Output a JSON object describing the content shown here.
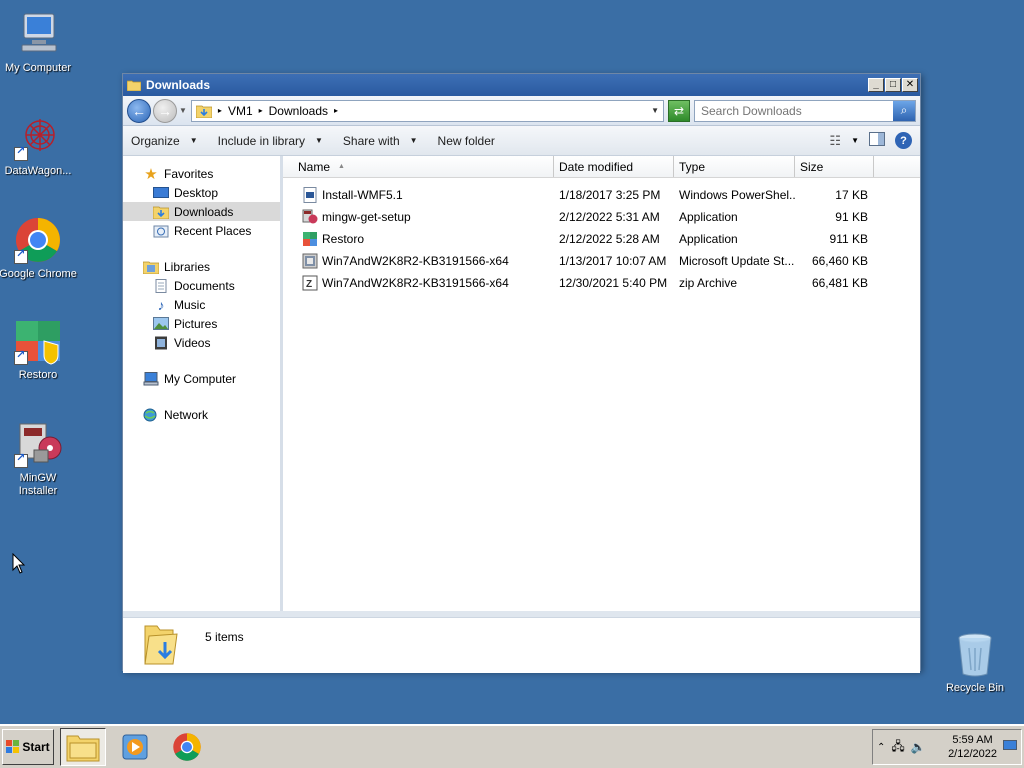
{
  "desktop": {
    "icons": [
      {
        "label": "My Computer",
        "icon": "computer-icon"
      },
      {
        "label": "DataWagon...",
        "icon": "datawagon-icon"
      },
      {
        "label": "Google Chrome",
        "icon": "chrome-icon"
      },
      {
        "label": "Restoro",
        "icon": "restoro-icon"
      },
      {
        "label": "MinGW Installer",
        "icon": "mingw-icon"
      },
      {
        "label": "Recycle Bin",
        "icon": "recycle-bin-icon"
      }
    ]
  },
  "window": {
    "title": "Downloads",
    "address": {
      "segments": [
        "VM1",
        "Downloads"
      ]
    },
    "search": {
      "placeholder": "Search Downloads"
    },
    "toolbar": {
      "organize": "Organize",
      "include_in_library": "Include in library",
      "share_with": "Share with",
      "new_folder": "New folder"
    },
    "navpane": {
      "favorites": "Favorites",
      "desktop": "Desktop",
      "downloads": "Downloads",
      "recent_places": "Recent Places",
      "libraries": "Libraries",
      "documents": "Documents",
      "music": "Music",
      "pictures": "Pictures",
      "videos": "Videos",
      "my_computer": "My Computer",
      "network": "Network"
    },
    "columns": {
      "name": "Name",
      "date_modified": "Date modified",
      "type": "Type",
      "size": "Size"
    },
    "files": [
      {
        "name": "Install-WMF5.1",
        "date": "1/18/2017 3:25 PM",
        "type": "Windows PowerShel...",
        "size": "17 KB",
        "icon": "powershell-script-icon"
      },
      {
        "name": "mingw-get-setup",
        "date": "2/12/2022 5:31 AM",
        "type": "Application",
        "size": "91 KB",
        "icon": "mingw-setup-icon"
      },
      {
        "name": "Restoro",
        "date": "2/12/2022 5:28 AM",
        "type": "Application",
        "size": "911 KB",
        "icon": "restoro-app-icon"
      },
      {
        "name": "Win7AndW2K8R2-KB3191566-x64",
        "date": "1/13/2017 10:07 AM",
        "type": "Microsoft Update St...",
        "size": "66,460 KB",
        "icon": "msu-package-icon"
      },
      {
        "name": "Win7AndW2K8R2-KB3191566-x64",
        "date": "12/30/2021 5:40 PM",
        "type": "zip Archive",
        "size": "66,481 KB",
        "icon": "zip-archive-icon"
      }
    ],
    "status": {
      "item_count": "5 items"
    }
  },
  "taskbar": {
    "start_label": "Start",
    "clock_time": "5:59 AM",
    "clock_date": "2/12/2022"
  }
}
